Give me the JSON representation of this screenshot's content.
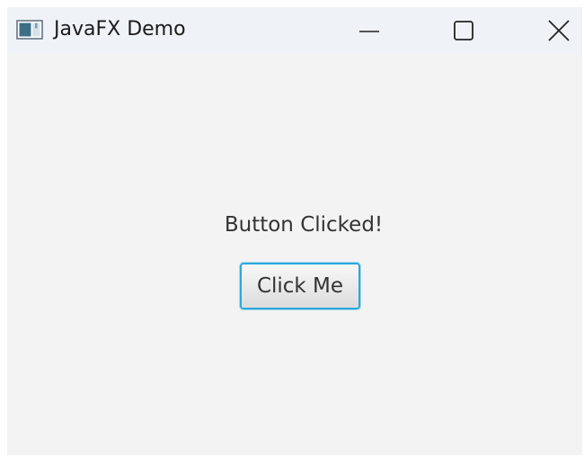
{
  "window": {
    "title": "JavaFX Demo",
    "icon": "java-app-icon",
    "controls": {
      "minimize_icon": "minimize-icon",
      "maximize_icon": "maximize-icon",
      "close_icon": "close-icon"
    }
  },
  "content": {
    "status_text": "Button Clicked!",
    "button_label": "Click Me"
  },
  "colors": {
    "window_background": "#f3f3f3",
    "titlebar_background": "#eff2f6",
    "button_focus_border": "#2ba8dc"
  }
}
